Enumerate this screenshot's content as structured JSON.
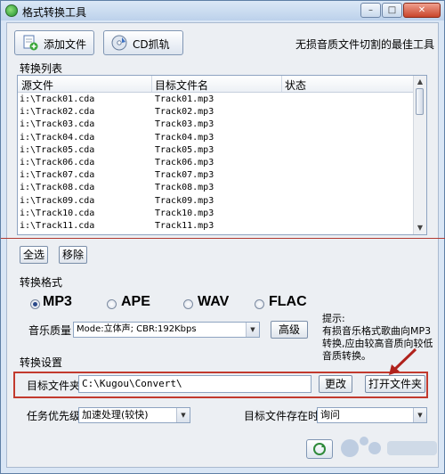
{
  "window": {
    "title": "格式转换工具"
  },
  "toolbar": {
    "add_file_label": "添加文件",
    "cd_rip_label": "CD抓轨",
    "slogan": "无损音质文件切割的最佳工具"
  },
  "file_list": {
    "section_label": "转换列表",
    "columns": [
      "源文件",
      "目标文件名",
      "状态"
    ],
    "rows": [
      {
        "source": "i:\\Track01.cda",
        "target": "Track01.mp3",
        "status": ""
      },
      {
        "source": "i:\\Track02.cda",
        "target": "Track02.mp3",
        "status": ""
      },
      {
        "source": "i:\\Track03.cda",
        "target": "Track03.mp3",
        "status": ""
      },
      {
        "source": "i:\\Track04.cda",
        "target": "Track04.mp3",
        "status": ""
      },
      {
        "source": "i:\\Track05.cda",
        "target": "Track05.mp3",
        "status": ""
      },
      {
        "source": "i:\\Track06.cda",
        "target": "Track06.mp3",
        "status": ""
      },
      {
        "source": "i:\\Track07.cda",
        "target": "Track07.mp3",
        "status": ""
      },
      {
        "source": "i:\\Track08.cda",
        "target": "Track08.mp3",
        "status": ""
      },
      {
        "source": "i:\\Track09.cda",
        "target": "Track09.mp3",
        "status": ""
      },
      {
        "source": "i:\\Track10.cda",
        "target": "Track10.mp3",
        "status": ""
      },
      {
        "source": "i:\\Track11.cda",
        "target": "Track11.mp3",
        "status": ""
      }
    ],
    "select_all_label": "全选",
    "remove_label": "移除"
  },
  "format": {
    "section_label": "转换格式",
    "options": [
      "MP3",
      "APE",
      "WAV",
      "FLAC"
    ],
    "selected": "MP3",
    "quality_label": "音乐质量",
    "quality_value": "Mode:立体声; CBR:192Kbps",
    "advanced_label": "高级",
    "hint": "提示:\n    有损音乐格式歌曲向MP3转换,应由较高音质向较低音质转换。"
  },
  "settings": {
    "section_label": "转换设置",
    "target_folder_label": "目标文件夹",
    "target_folder_value": "C:\\Kugou\\Convert\\",
    "change_label": "更改",
    "open_folder_label": "打开文件夹",
    "priority_label": "任务优先级",
    "priority_value": "加速处理(较快)",
    "exists_label": "目标文件存在时",
    "exists_value": "询问"
  },
  "colors": {
    "accent": "#c23a2e",
    "window_frame": "#5f7fa6",
    "panel": "#eceff3"
  }
}
